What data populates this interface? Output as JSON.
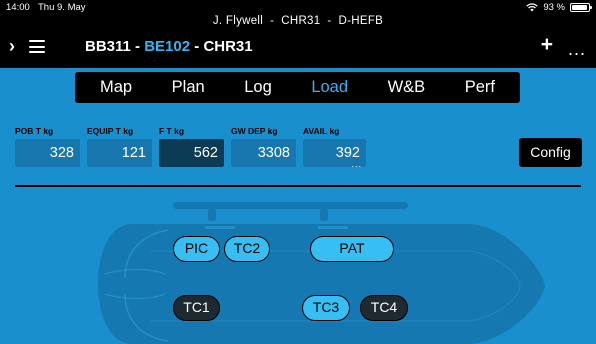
{
  "status": {
    "time": "14:00",
    "date": "Thu 9. May",
    "battery": "93 %",
    "wifi_icon": "wifi-icon",
    "battery_icon": "battery-icon"
  },
  "header": {
    "subtitle": "J. Flywell  -  CHR31  -  D-HEFB",
    "route": {
      "from": "BB311",
      "sep1": " - ",
      "current": "BE102",
      "sep2": " - ",
      "to": "CHR31"
    },
    "add": "+",
    "more": "..."
  },
  "tabs": [
    {
      "label": "Map",
      "active": false
    },
    {
      "label": "Plan",
      "active": false
    },
    {
      "label": "Log",
      "active": false
    },
    {
      "label": "Load",
      "active": true
    },
    {
      "label": "W&B",
      "active": false
    },
    {
      "label": "Perf",
      "active": false
    }
  ],
  "fields": {
    "pob": {
      "label": "POB T kg",
      "value": "328"
    },
    "equip": {
      "label": "EQUIP T kg",
      "value": "121"
    },
    "fuel": {
      "label": "F T kg",
      "value": "562"
    },
    "gw_dep": {
      "label": "GW DEP kg",
      "value": "3308"
    },
    "avail": {
      "label": "AVAIL kg",
      "value": "392",
      "dots": "..."
    }
  },
  "config_label": "Config",
  "seats": {
    "pic": "PIC",
    "tc2": "TC2",
    "pat": "PAT",
    "tc1": "TC1",
    "tc3": "TC3",
    "tc4": "TC4"
  },
  "colors": {
    "background": "#1a8fcd",
    "accent": "#36b3f0",
    "field": "#1776ae",
    "field_dark": "#0c3b56",
    "header": "#000000"
  }
}
